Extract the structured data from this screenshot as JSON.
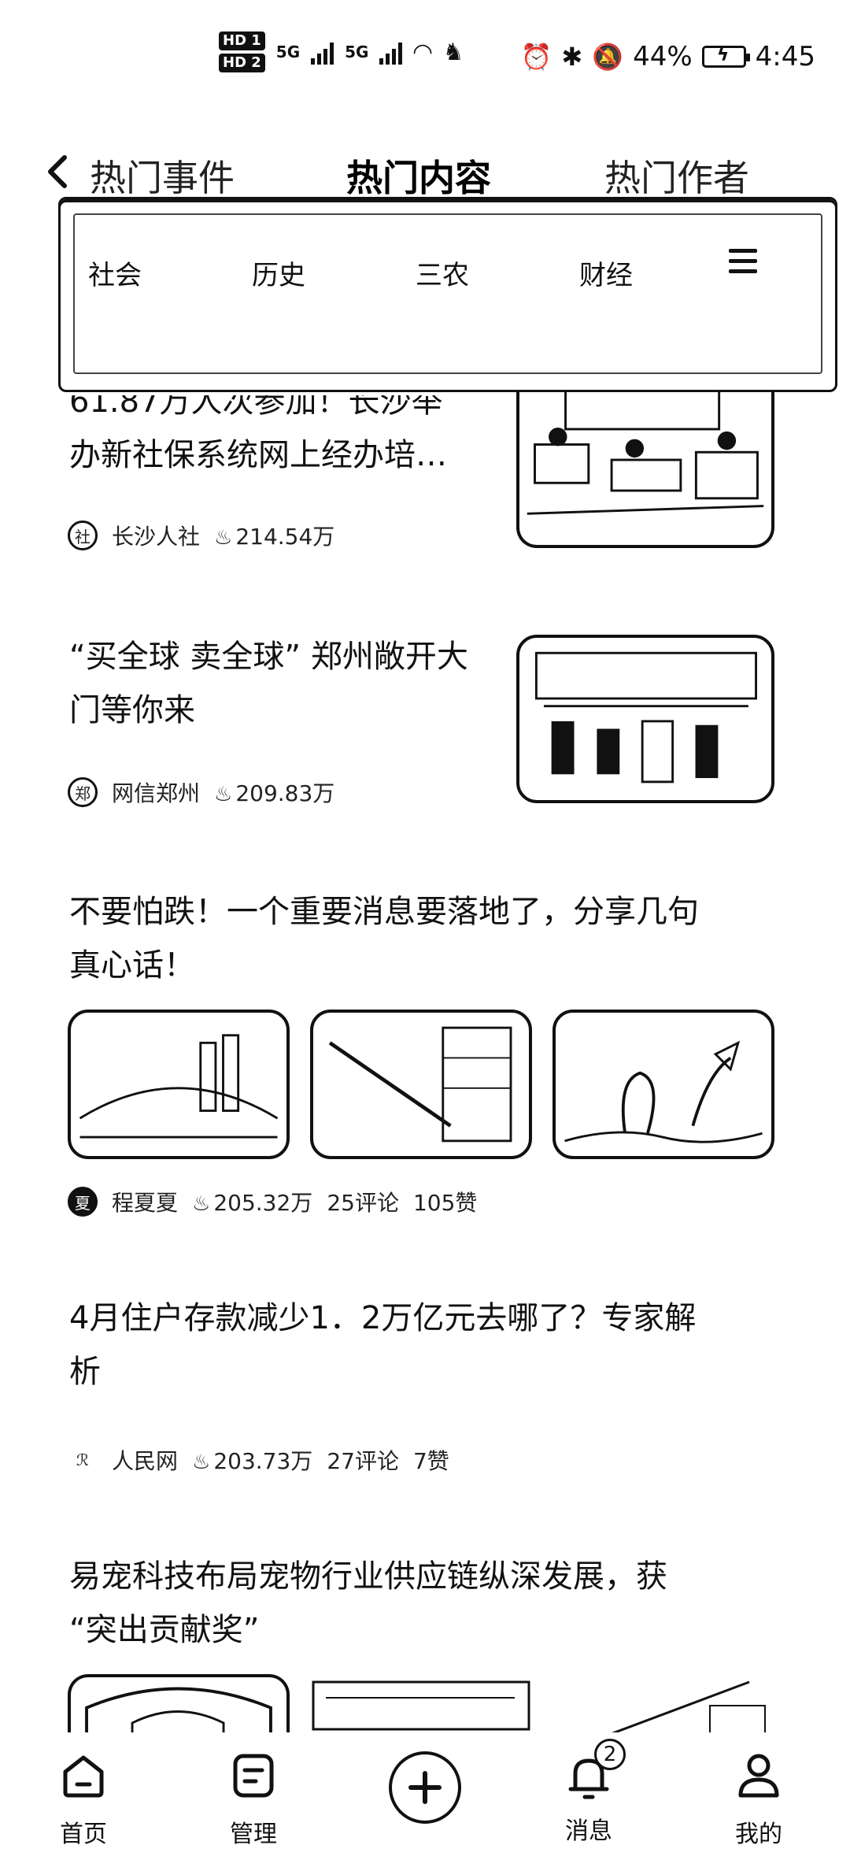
{
  "status_bar": {
    "hd1": "HD 1",
    "hd2": "HD 2",
    "net1": "5G",
    "net2": "5G",
    "battery": "44%",
    "time": "4:45"
  },
  "header": {
    "tabs": [
      {
        "label": "热门事件"
      },
      {
        "label": "热门内容",
        "active": true
      },
      {
        "label": "热门作者"
      }
    ]
  },
  "categories": [
    "社会",
    "历史",
    "三农",
    "财经"
  ],
  "articles": [
    {
      "title_line1": "61.87万人次参加！长沙举",
      "title_line2": "办新社保系统网上经办培…",
      "author": "长沙人社",
      "views": "214.54万"
    },
    {
      "title_line1": "“买全球 卖全球” 郑州敞开大",
      "title_line2": "门等你来",
      "author": "网信郑州",
      "views": "209.83万"
    },
    {
      "title_line1": "不要怕跌！一个重要消息要落地了，分享几句",
      "title_line2": "真心话！",
      "author": "程夏夏",
      "views": "205.32万",
      "comments": "25评论",
      "likes": "105赞"
    },
    {
      "title_line1": "4月住户存款减少1．2万亿元去哪了？专家解",
      "title_line2": "析",
      "author": "人民网",
      "views": "203.73万",
      "comments": "27评论",
      "likes": "7赞"
    },
    {
      "title_line1": "易宠科技布局宠物行业供应链纵深发展，获",
      "title_line2": "“突出贡献奖”"
    }
  ],
  "bottom_nav": {
    "home": "首页",
    "manage": "管理",
    "messages": "消息",
    "messages_badge": "2",
    "me": "我的"
  }
}
